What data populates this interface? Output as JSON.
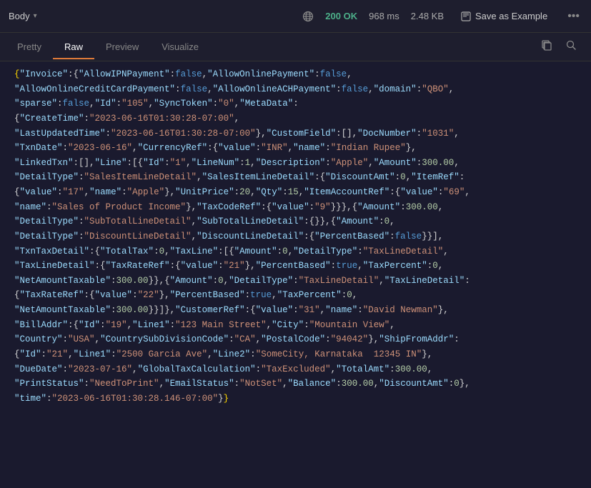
{
  "topbar": {
    "body_label": "Body",
    "status_code": "200 OK",
    "time": "968 ms",
    "size": "2.48 KB",
    "save_example": "Save as Example",
    "chevron": "▾",
    "more": "•••"
  },
  "tabs": {
    "pretty": "Pretty",
    "raw": "Raw",
    "preview": "Preview",
    "visualize": "Visualize",
    "active": "Raw"
  },
  "json_content": "{\"Invoice\":{\"AllowIPNPayment\":false,\"AllowOnlinePayment\":false,\n\"AllowOnlineCreditCardPayment\":false,\"AllowOnlineACHPayment\":false,\"domain\":\"QBO\",\n\"sparse\":false,\"Id\":\"105\",\"SyncToken\":\"0\",\"MetaData\":\n{\"CreateTime\":\"2023-06-16T01:30:28-07:00\",\n\"LastUpdatedTime\":\"2023-06-16T01:30:28-07:00\"},\"CustomField\":[],\"DocNumber\":\"1031\",\n\"TxnDate\":\"2023-06-16\",\"CurrencyRef\":{\"value\":\"INR\",\"name\":\"Indian Rupee\"},\n\"LinkedTxn\":[],\"Line\":[{\"Id\":\"1\",\"LineNum\":1,\"Description\":\"Apple\",\"Amount\":300.00,\n\"DetailType\":\"SalesItemLineDetail\",\"SalesItemLineDetail\":{\"DiscountAmt\":0,\"ItemRef\":\n{\"value\":\"17\",\"name\":\"Apple\"},\"UnitPrice\":20,\"Qty\":15,\"ItemAccountRef\":{\"value\":\"69\",\n\"name\":\"Sales of Product Income\"},\"TaxCodeRef\":{\"value\":\"9\"}}},{\"Amount\":300.00,\n\"DetailType\":\"SubTotalLineDetail\",\"SubTotalLineDetail\":{}},{\"Amount\":0,\n\"DetailType\":\"DiscountLineDetail\",\"DiscountLineDetail\":{\"PercentBased\":false}},\n\"TxnTaxDetail\":{\"TotalTax\":0,\"TaxLine\":[{\"Amount\":0,\"DetailType\":\"TaxLineDetail\",\n\"TaxLineDetail\":{\"TaxRateRef\":{\"value\":\"21\"},\"PercentBased\":true,\"TaxPercent\":0,\n\"NetAmountTaxable\":300.00}},{\"Amount\":0,\"DetailType\":\"TaxLineDetail\",\"TaxLineDetail\":\n{\"TaxRateRef\":{\"value\":\"22\"},\"PercentBased\":true,\"TaxPercent\":0,\n\"NetAmountTaxable\":300.00}}],\"CustomerRef\":{\"value\":\"31\",\"name\":\"David Newman\"},\n\"BillAddr\":{\"Id\":\"19\",\"Line1\":\"123 Main Street\",\"City\":\"Mountain View\",\n\"Country\":\"USA\",\"CountrySubDivisionCode\":\"CA\",\"PostalCode\":\"94042\"},\"ShipFromAddr\":\n{\"Id\":\"21\",\"Line1\":\"2500 Garcia Ave\",\"Line2\":\"SomeCity, Karnataka  12345 IN\"},\n\"DueDate\":\"2023-07-16\",\"GlobalTaxCalculation\":\"TaxExcluded\",\"TotalAmt\":300.00,\n\"PrintStatus\":\"NeedToPrint\",\"EmailStatus\":\"NotSet\",\"Balance\":300.00,\"DiscountAmt\":0},\n\"time\":\"2023-06-16T01:30:28.146-07:00\"}"
}
